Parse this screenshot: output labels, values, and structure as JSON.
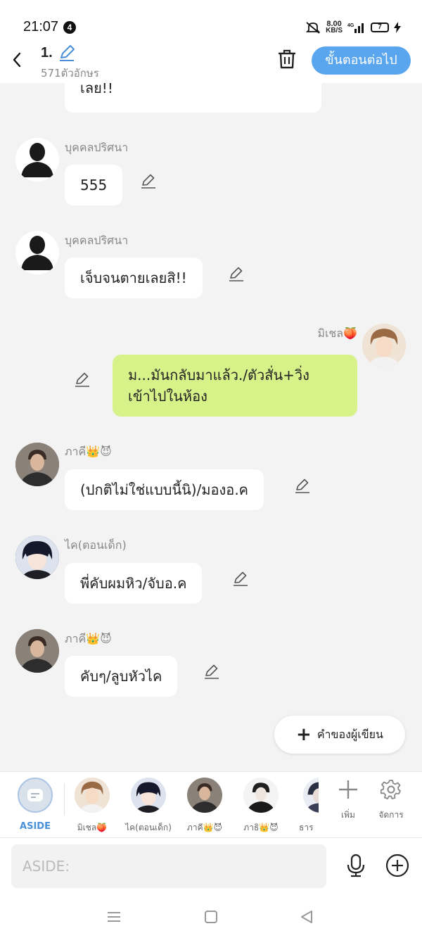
{
  "status_bar": {
    "time": "21:07",
    "notification_count": "4",
    "net_speed_value": "8.00",
    "net_speed_unit": "KB/S",
    "network": "4G",
    "battery": "7"
  },
  "header": {
    "episode_title": "1.",
    "char_count": "571ตัวอักษร",
    "next_button": "ขั้นตอนต่อไป"
  },
  "messages": [
    {
      "speaker": "",
      "text": "เลย!!",
      "side": "left"
    },
    {
      "speaker": "บุคคลปริศนา",
      "text": "555",
      "side": "left"
    },
    {
      "speaker": "บุคคลปริศนา",
      "text": "เจ็บจนตายเลยสิ!!",
      "side": "left"
    },
    {
      "speaker": "มิเชล🍑",
      "text_lines": [
        "ม...มันกลับมาแล้ว./ตัวสั่น+วิ่ง",
        "เข้าไปในห้อง"
      ],
      "side": "right"
    },
    {
      "speaker": "ภาคี👑😈",
      "text": "(ปกติไม่ใช่แบบนี้นิ)/มองอ.ค",
      "side": "left"
    },
    {
      "speaker": "ไค(ตอนเด็ก)",
      "text": "พี่คับผมหิว/จับอ.ค",
      "side": "left"
    },
    {
      "speaker": "ภาคี👑😈",
      "text": "คับๆ/ลูบหัวไค",
      "side": "left"
    }
  ],
  "writer_note_button": "คำของผู้เขียน",
  "character_bar": {
    "aside_label": "ASIDE",
    "characters": [
      "มิเชล🍑",
      "ไค(ตอนเด็ก)",
      "ภาคี👑😈",
      "ภาธิ👑😈",
      "ธาร"
    ],
    "add_label": "เพิ่ม",
    "manage_label": "จัดการ"
  },
  "input": {
    "placeholder": "ASIDE:"
  },
  "colors": {
    "accent": "#5aa6ee",
    "my_bubble": "#d8f28a",
    "background": "#f3f3f3"
  }
}
